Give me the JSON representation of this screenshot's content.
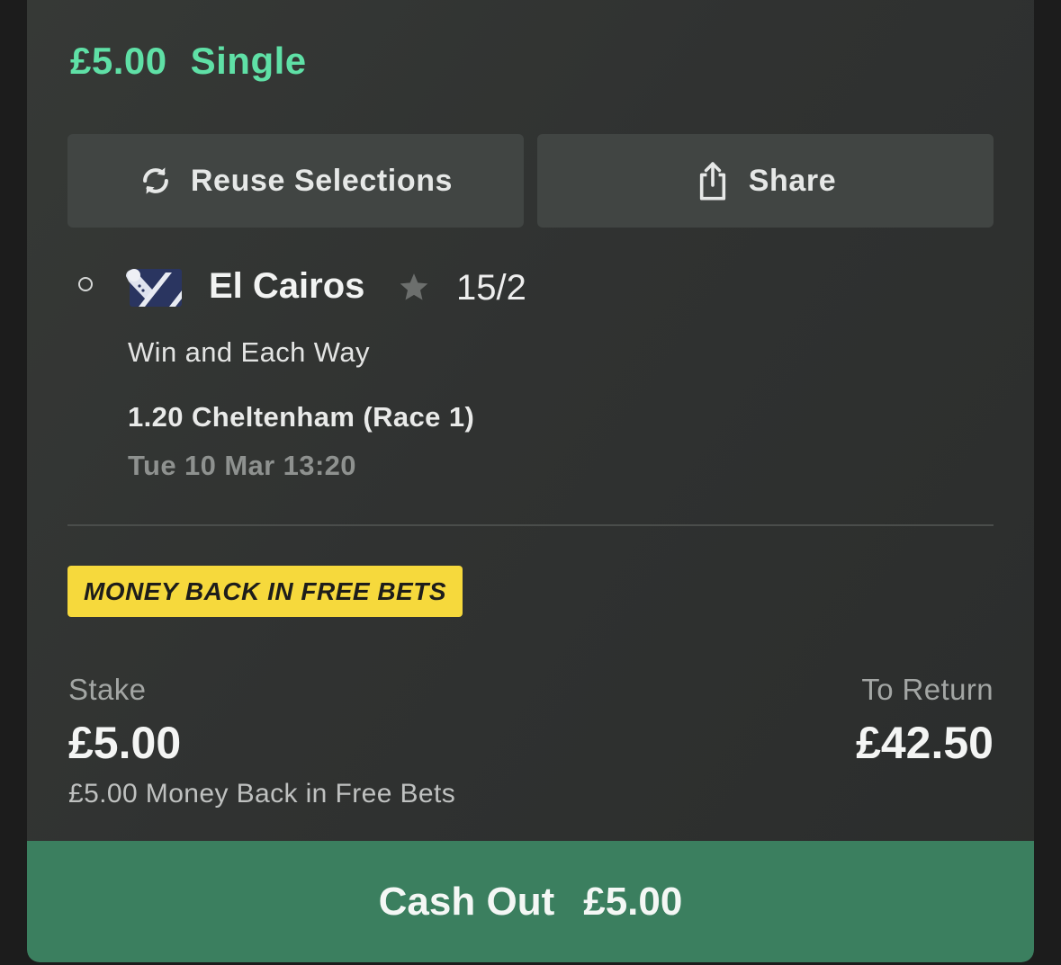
{
  "bet": {
    "stake_header": "£5.00",
    "type": "Single"
  },
  "actions": {
    "reuse_label": "Reuse Selections",
    "share_label": "Share"
  },
  "selection": {
    "horse": "El Cairos",
    "odds": "15/2",
    "market": "Win and Each Way",
    "race": "1.20 Cheltenham (Race 1)",
    "race_time": "Tue 10 Mar 13:20",
    "favourite_icon": "star-icon",
    "silks_icon": "jockey-silks-icon"
  },
  "promo": {
    "badge": "MONEY BACK IN FREE BETS"
  },
  "summary": {
    "stake_label": "Stake",
    "stake_value": "£5.00",
    "return_label": "To Return",
    "return_value": "£42.50",
    "note": "£5.00 Money Back in Free Bets"
  },
  "cashout": {
    "label": "Cash Out",
    "amount": "£5.00"
  },
  "colors": {
    "accent_green": "#5fe0a6",
    "cashout_green": "#3b7f5f",
    "promo_yellow": "#f6d93c",
    "card_bg": "#333634"
  }
}
